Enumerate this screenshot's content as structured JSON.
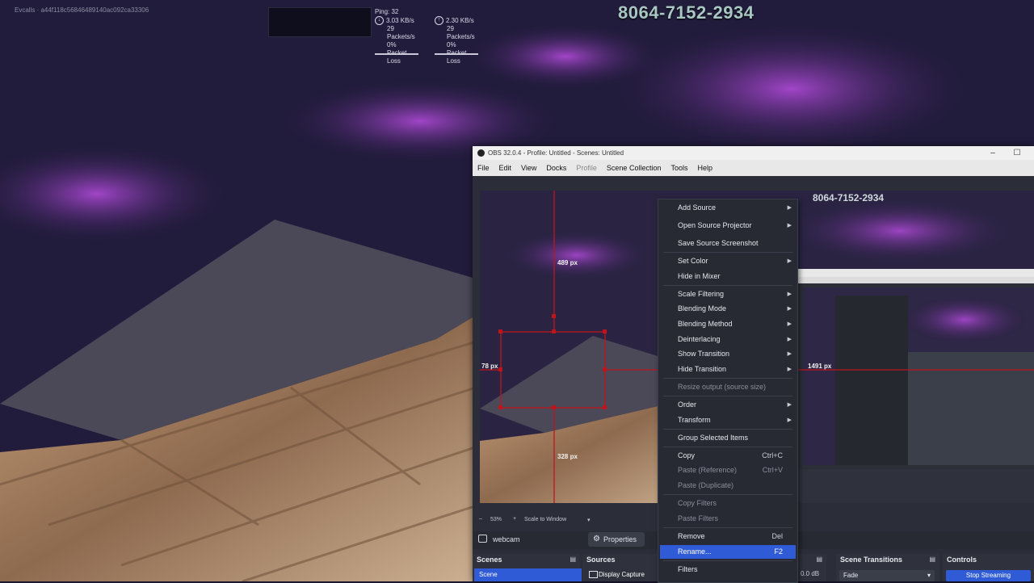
{
  "stream_overlay": {
    "id_text": "Evcalls · a44f118c56846489140ac092ca33306",
    "ping": "Ping: 32",
    "down_rate": "3.03 KB/s",
    "down_packets": "29 Packets/s",
    "down_loss": "0% Packet Loss",
    "up_rate": "2.30 KB/s",
    "up_packets": "29 Packets/s",
    "up_loss": "0% Packet Loss",
    "access_code": "8064-7152-2934"
  },
  "obs": {
    "title": "OBS 32.0.4 - Profile: Untitled - Scenes: Untitled",
    "menu": [
      "File",
      "Edit",
      "View",
      "Docks",
      "Profile",
      "Scene Collection",
      "Tools",
      "Help"
    ],
    "preview": {
      "measure_top": "489 px",
      "measure_left": "78 px",
      "measure_right": "1491 px",
      "measure_bottom": "328 px",
      "access_code": "8064-7152-2934"
    },
    "toolbar": {
      "zoom": "53%",
      "scale_mode": "Scale to Window"
    },
    "source_bar": {
      "selected_source": "webcam",
      "properties_label": "Properties"
    },
    "docks": {
      "scenes_title": "Scenes",
      "scene_item": "Scene",
      "sources_title": "Sources",
      "source_item": "Display Capture",
      "audio_level": "0.0 dB",
      "transitions_title": "Scene Transitions",
      "transition_item": "Fade",
      "controls_title": "Controls",
      "stop_streaming": "Stop Streaming"
    }
  },
  "context_menu": {
    "items": [
      {
        "label": "Add Source",
        "submenu": true
      },
      {
        "label": "Open Source Projector",
        "submenu": true
      },
      {
        "label": "Save Source Screenshot"
      },
      {
        "label": "Set Color",
        "submenu": true
      },
      {
        "label": "Hide in Mixer"
      },
      {
        "label": "Scale Filtering",
        "submenu": true
      },
      {
        "label": "Blending Mode",
        "submenu": true
      },
      {
        "label": "Blending Method",
        "submenu": true
      },
      {
        "label": "Deinterlacing",
        "submenu": true
      },
      {
        "label": "Show Transition",
        "submenu": true
      },
      {
        "label": "Hide Transition",
        "submenu": true
      },
      {
        "label": "Resize output (source size)",
        "disabled": true
      },
      {
        "label": "Order",
        "submenu": true
      },
      {
        "label": "Transform",
        "submenu": true
      },
      {
        "label": "Group Selected Items"
      },
      {
        "label": "Copy",
        "shortcut": "Ctrl+C"
      },
      {
        "label": "Paste (Reference)",
        "shortcut": "Ctrl+V",
        "disabled": true
      },
      {
        "label": "Paste (Duplicate)",
        "disabled": true
      },
      {
        "label": "Copy Filters",
        "disabled": true
      },
      {
        "label": "Paste Filters",
        "disabled": true
      },
      {
        "label": "Remove",
        "shortcut": "Del"
      },
      {
        "label": "Rename...",
        "shortcut": "F2",
        "selected": true
      },
      {
        "label": "Filters"
      }
    ]
  },
  "colors": {
    "accent": "#2f5bd6",
    "obs_panel": "#2b2e38",
    "menu_bg": "#272a33",
    "guide_red": "#c0141c"
  }
}
